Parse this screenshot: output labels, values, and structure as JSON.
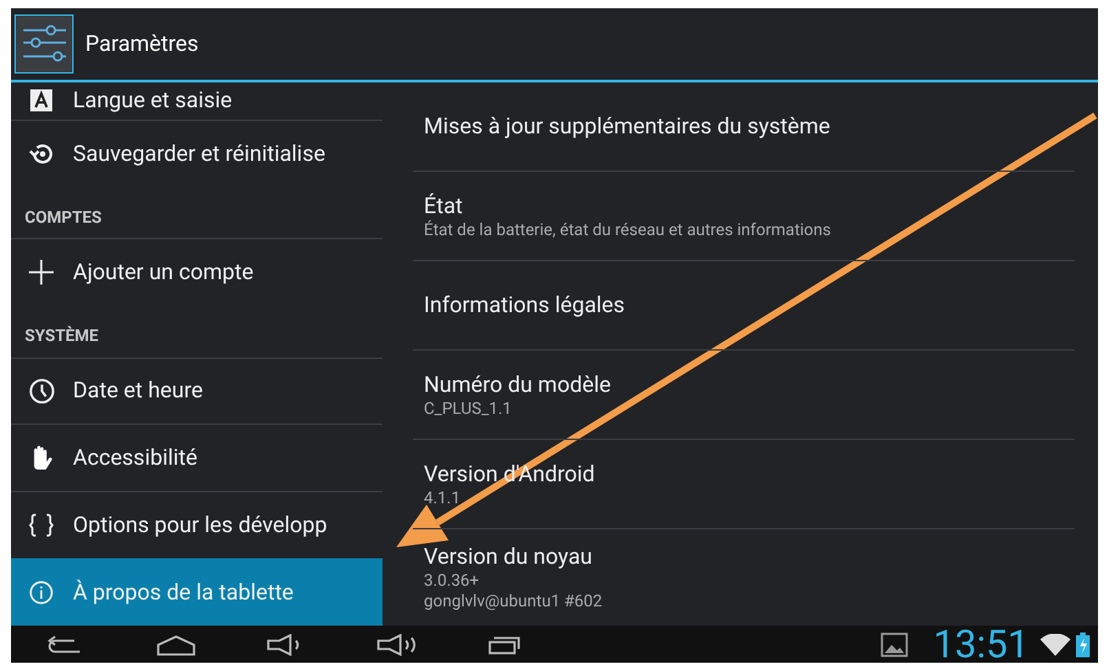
{
  "action_bar": {
    "title": "Paramètres"
  },
  "sidebar": {
    "items": [
      {
        "kind": "item",
        "label": "Langue et saisie",
        "selected": false
      },
      {
        "kind": "item",
        "label": "Sauvegarder et réinitialise",
        "selected": false
      },
      {
        "kind": "header",
        "label": "COMPTES"
      },
      {
        "kind": "item",
        "label": "Ajouter un compte",
        "selected": false
      },
      {
        "kind": "header",
        "label": "SYSTÈME"
      },
      {
        "kind": "item",
        "label": "Date et heure",
        "selected": false
      },
      {
        "kind": "item",
        "label": "Accessibilité",
        "selected": false
      },
      {
        "kind": "item",
        "label": "Options pour les développ",
        "selected": false
      },
      {
        "kind": "item",
        "label": "À propos de la tablette",
        "selected": true
      }
    ]
  },
  "details": [
    {
      "title": "Mises à jour supplémentaires du système"
    },
    {
      "title": "État",
      "summary": [
        "État de la batterie, état du réseau et autres informations"
      ]
    },
    {
      "title": "Informations légales"
    },
    {
      "title": "Numéro du modèle",
      "summary": [
        "C_PLUS_1.1"
      ]
    },
    {
      "title": "Version d'Android",
      "summary": [
        "4.1.1"
      ]
    },
    {
      "title": "Version du noyau",
      "summary": [
        "3.0.36+",
        "gonglvlv@ubuntu1 #602"
      ]
    }
  ],
  "status_bar": {
    "time": "13:51"
  }
}
